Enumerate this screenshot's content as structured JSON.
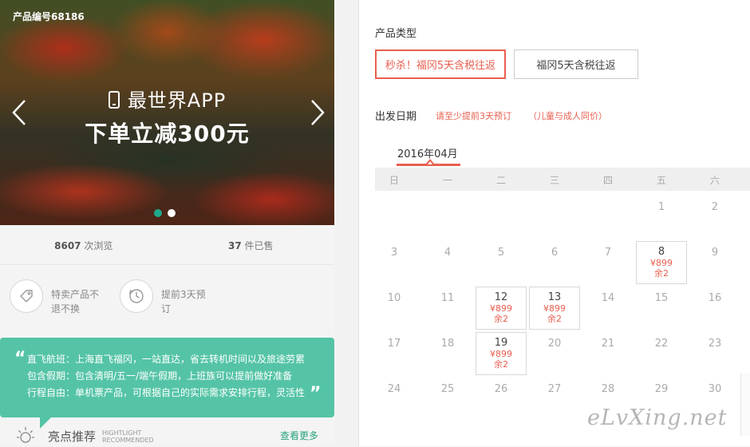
{
  "banner": {
    "product_code": "产品编号68186",
    "app_text": "最世界APP",
    "promo_text": "下单立减300元",
    "slides": 2,
    "active_slide": 1
  },
  "stats": {
    "views_num": "8607",
    "views_label": "次浏览",
    "sold_num": "37",
    "sold_label": "件已售"
  },
  "features": [
    {
      "icon": "tag-icon",
      "text": "特卖产品不退不换"
    },
    {
      "icon": "clock-icon",
      "text": "提前3天预订"
    }
  ],
  "highlights": {
    "quote_open": "“",
    "quote_close": "”",
    "lines": [
      "直飞航班：上海直飞福冈，一站直达，省去转机时间以及旅途劳累",
      "包含假期：包含清明/五一/端午假期，上班族可以提前做好准备",
      "行程自由：单机票产品，可根据自己的实际需求安排行程，灵活性"
    ]
  },
  "recommend": {
    "title": "亮点推荐",
    "en_line1": "HIGHTLIGHT",
    "en_line2": "RECOMMENDED",
    "more": "查看更多"
  },
  "product_type": {
    "title": "产品类型",
    "options": [
      "秒杀！福冈5天含税往返",
      "福冈5天含税往返"
    ],
    "selected": 0
  },
  "departure": {
    "title": "出发日期",
    "note1": "请至少提前3天预订",
    "note2": "（儿童与成人同价）"
  },
  "calendar": {
    "month": "2016年04月",
    "weekdays": [
      "日",
      "一",
      "二",
      "三",
      "四",
      "五",
      "六"
    ],
    "rows": [
      [
        null,
        null,
        null,
        null,
        null,
        {
          "day": "1"
        },
        {
          "day": "2"
        }
      ],
      [
        {
          "day": "3"
        },
        {
          "day": "4"
        },
        {
          "day": "5"
        },
        {
          "day": "6"
        },
        {
          "day": "7"
        },
        {
          "day": "8",
          "price": "¥899",
          "left": "余2"
        },
        {
          "day": "9"
        }
      ],
      [
        {
          "day": "10"
        },
        {
          "day": "11"
        },
        {
          "day": "12",
          "price": "¥899",
          "left": "余2"
        },
        {
          "day": "13",
          "price": "¥899",
          "left": "余2"
        },
        {
          "day": "14"
        },
        {
          "day": "15"
        },
        {
          "day": "16"
        }
      ],
      [
        {
          "day": "17"
        },
        {
          "day": "18"
        },
        {
          "day": "19",
          "price": "¥899",
          "left": "余2"
        },
        {
          "day": "20"
        },
        {
          "day": "21"
        },
        {
          "day": "22"
        },
        {
          "day": "23"
        }
      ],
      [
        {
          "day": "24"
        },
        {
          "day": "25"
        },
        {
          "day": "26"
        },
        {
          "day": "27"
        },
        {
          "day": "28"
        },
        {
          "day": "29"
        },
        {
          "day": "30"
        }
      ]
    ]
  },
  "watermark": "eLvXing.net",
  "colors": {
    "accent": "#e85f4f",
    "green": "#55c4a6",
    "link_green": "#2aa37f"
  }
}
